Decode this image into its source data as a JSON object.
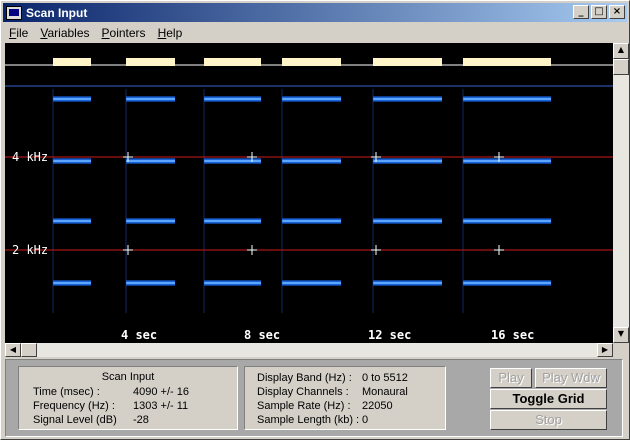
{
  "window": {
    "title": "Scan Input",
    "controls": {
      "minimize": "_",
      "maximize": "□",
      "close": "×"
    }
  },
  "menu": [
    {
      "label": "File",
      "key": "F",
      "rest": "ile"
    },
    {
      "label": "Variables",
      "key": "V",
      "rest": "ariables"
    },
    {
      "label": "Pointers",
      "key": "P",
      "rest": "ointers"
    },
    {
      "label": "Help",
      "key": "H",
      "rest": "elp"
    }
  ],
  "spectrogram": {
    "frequency_labels": [
      "4 kHz",
      "2 kHz"
    ],
    "time_labels": [
      "4 sec",
      "8 sec",
      "12 sec",
      "16 sec"
    ],
    "colors": {
      "background": "#000000",
      "band": "#1e90ff",
      "band_core": "#9fd8ff",
      "grid": "#cc1a1a",
      "marker": "#fff5c8",
      "axis": "#ffffff"
    }
  },
  "scan_input": {
    "title": "Scan Input",
    "rows": [
      {
        "label": "Time (msec) :",
        "value": "4090 +/- 16"
      },
      {
        "label": "Frequency (Hz) :",
        "value": "1303 +/- 11"
      },
      {
        "label": "Signal Level (dB)",
        "value": "-28"
      }
    ]
  },
  "display_info": {
    "rows": [
      {
        "label": "Display Band (Hz) :",
        "value": "0 to 5512"
      },
      {
        "label": "Display Channels :",
        "value": "Monaural"
      },
      {
        "label": "Sample Rate (Hz) :",
        "value": "22050"
      },
      {
        "label": "Sample Length (kb) :",
        "value": "0"
      }
    ]
  },
  "buttons": {
    "play": "Play",
    "play_wdw": "Play Wdw",
    "toggle_grid": "Toggle Grid",
    "stop": "Stop"
  }
}
